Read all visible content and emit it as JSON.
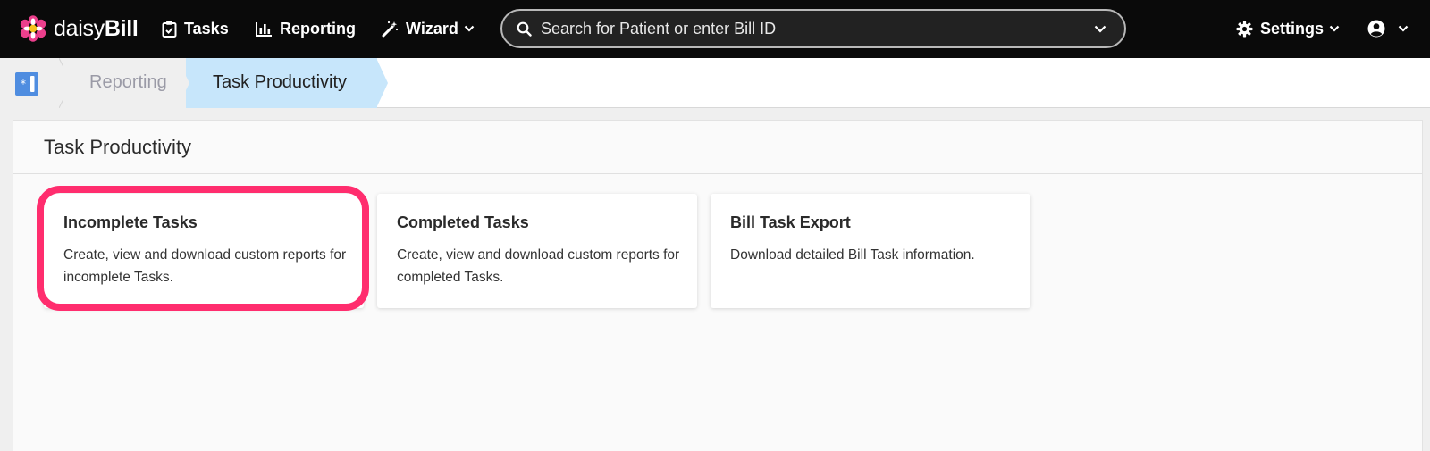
{
  "app": {
    "logo_light": "daisy",
    "logo_bold": "Bill"
  },
  "nav": {
    "tasks": "Tasks",
    "reporting": "Reporting",
    "wizard": "Wizard",
    "settings": "Settings"
  },
  "search": {
    "placeholder": "Search for Patient or enter Bill ID"
  },
  "breadcrumb": {
    "reporting": "Reporting",
    "current": "Task Productivity"
  },
  "page": {
    "title": "Task Productivity"
  },
  "cards": [
    {
      "title": "Incomplete Tasks",
      "desc": "Create, view and download custom reports for incomplete Tasks."
    },
    {
      "title": "Completed Tasks",
      "desc": "Create, view and download custom reports for completed Tasks."
    },
    {
      "title": "Bill Task Export",
      "desc": "Download detailed Bill Task information."
    }
  ],
  "colors": {
    "accent_highlight": "#ff2d6e",
    "crumb_active": "#c7e6fb",
    "topbar": "#0a0a0a"
  },
  "icons": [
    "daisy-logo-icon",
    "clipboard-check-icon",
    "bar-chart-icon",
    "magic-wand-icon",
    "search-icon",
    "chevron-down-icon",
    "gear-icon",
    "user-circle-icon",
    "home-icon"
  ]
}
